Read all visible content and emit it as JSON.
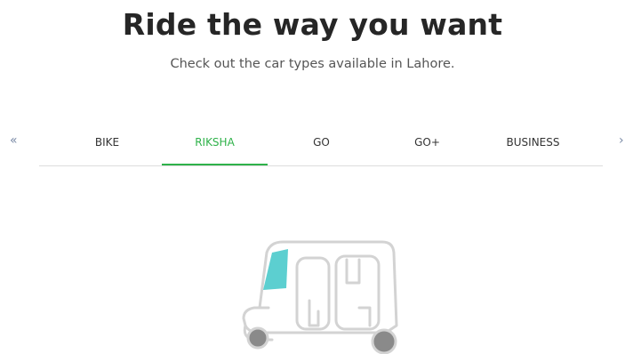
{
  "header": {
    "title": "Ride the way you want",
    "subtitle": "Check out the car types available in Lahore."
  },
  "carousel": {
    "prev_icon": "«",
    "next_icon": "›",
    "tabs": [
      {
        "label": "BIKE",
        "active": false
      },
      {
        "label": "RIKSHA",
        "active": true
      },
      {
        "label": "GO",
        "active": false
      },
      {
        "label": "GO+",
        "active": false
      },
      {
        "label": "BUSINESS",
        "active": false
      }
    ]
  },
  "vehicle": {
    "icon": "riksha-icon"
  },
  "colors": {
    "accent": "#2fb24a",
    "windshield": "#5ccfd0",
    "outline": "#d3d3d3",
    "wheel": "#8a8a8a"
  }
}
